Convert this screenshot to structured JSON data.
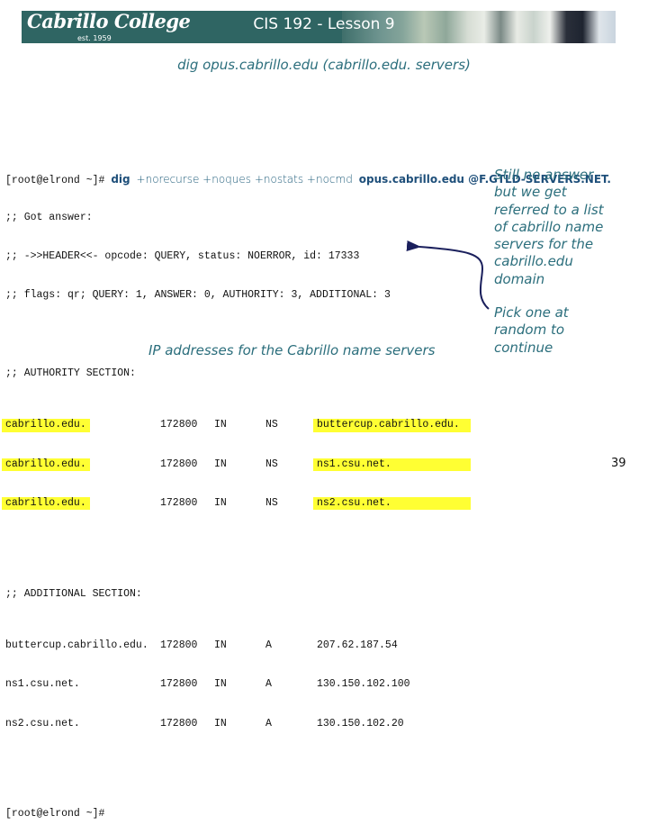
{
  "header": {
    "logo_text": "Cabrillo College",
    "logo_est": "est. 1959",
    "title": "CIS 192 - Lesson 9"
  },
  "subtitle": "dig opus.cabrillo.edu (cabrillo.edu. servers)",
  "terminal": {
    "prompt": "[root@elrond ~]#",
    "command": {
      "dig": "dig",
      "options": "+norecurse +noques +nostats +nocmd",
      "target": "opus.cabrillo.edu @F.GTLD-SERVERS.NET."
    },
    "header_lines": [
      ";; Got answer:",
      ";; ->>HEADER<<- opcode: QUERY, status: NOERROR, id: 17333",
      ";; flags: qr; QUERY: 1, ANSWER: 0, AUTHORITY: 3, ADDITIONAL: 3"
    ],
    "authority_section": {
      "heading": ";; AUTHORITY SECTION:",
      "rows": [
        {
          "name": "cabrillo.edu.",
          "ttl": "172800",
          "class": "IN",
          "type": "NS",
          "value": "buttercup.cabrillo.edu."
        },
        {
          "name": "cabrillo.edu.",
          "ttl": "172800",
          "class": "IN",
          "type": "NS",
          "value": "ns1.csu.net."
        },
        {
          "name": "cabrillo.edu.",
          "ttl": "172800",
          "class": "IN",
          "type": "NS",
          "value": "ns2.csu.net."
        }
      ]
    },
    "additional_section": {
      "heading": ";; ADDITIONAL SECTION:",
      "rows": [
        {
          "name": "buttercup.cabrillo.edu.",
          "ttl": "172800",
          "class": "IN",
          "type": "A",
          "value": "207.62.187.54"
        },
        {
          "name": "ns1.csu.net.",
          "ttl": "172800",
          "class": "IN",
          "type": "A",
          "value": "130.150.102.100"
        },
        {
          "name": "ns2.csu.net.",
          "ttl": "172800",
          "class": "IN",
          "type": "A",
          "value": "130.150.102.20"
        }
      ]
    },
    "final_prompt": "[root@elrond ~]#"
  },
  "notes": {
    "referral": [
      "Still no answer",
      "but we get",
      "referred to a list",
      "of cabrillo name",
      "servers for the",
      "cabrillo.edu",
      "domain"
    ],
    "pick": [
      "Pick one at",
      "random to",
      "continue"
    ],
    "ip": "IP addresses for the Cabrillo name servers"
  },
  "colors": {
    "banner": "#2f6563",
    "note_text": "#2b6e7c",
    "highlight": "#ffff33",
    "arrow": "#1a1f5c"
  },
  "page_number": "39"
}
